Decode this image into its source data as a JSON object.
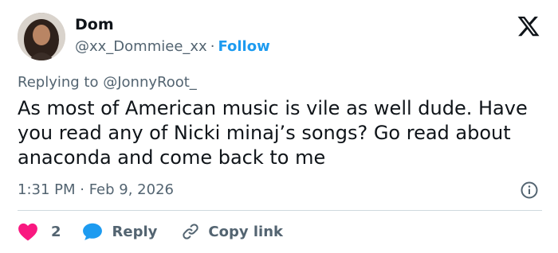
{
  "author": {
    "name": "Dom",
    "handle": "@xx_Dommiee_xx",
    "separator": "·",
    "follow_label": "Follow"
  },
  "reply_context": {
    "prefix": "Replying to",
    "mention": "@JonnyRoot_"
  },
  "tweet": {
    "text": "As most of American music is vile as well dude. Have you read any of Nicki minaj’s songs? Go read about anaconda and come back to me",
    "timestamp": "1:31 PM · Feb 9, 2026"
  },
  "actions": {
    "like_count": "2",
    "reply_label": "Reply",
    "copy_label": "Copy link"
  },
  "icons": {
    "platform": "x-logo-icon",
    "info": "info-icon",
    "like": "heart-icon",
    "reply": "speech-bubble-icon",
    "copy": "link-icon"
  },
  "colors": {
    "text": "#0f1419",
    "secondary": "#536471",
    "accent": "#1d9bf0",
    "like": "#f91880",
    "divider": "#cfd9de"
  }
}
